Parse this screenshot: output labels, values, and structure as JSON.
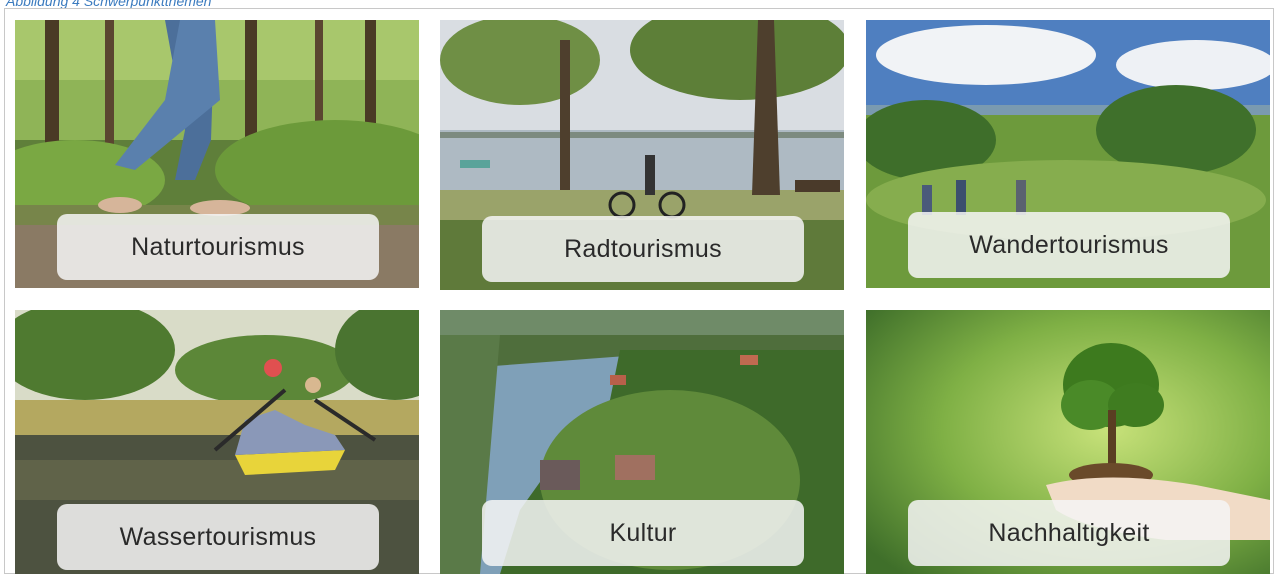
{
  "caption": "Abbildung 4 Schwerpunktthemen",
  "tiles": [
    {
      "label": "Naturtourismus",
      "image": "forest-walk-photo"
    },
    {
      "label": "Radtourismus",
      "image": "lake-cyclist-photo"
    },
    {
      "label": "Wandertourismus",
      "image": "hiking-meadow-photo"
    },
    {
      "label": "Wassertourismus",
      "image": "canoe-lake-photo"
    },
    {
      "label": "Kultur",
      "image": "aerial-lake-town-photo"
    },
    {
      "label": "Nachhaltigkeit",
      "image": "tree-in-hands-photo"
    }
  ]
}
